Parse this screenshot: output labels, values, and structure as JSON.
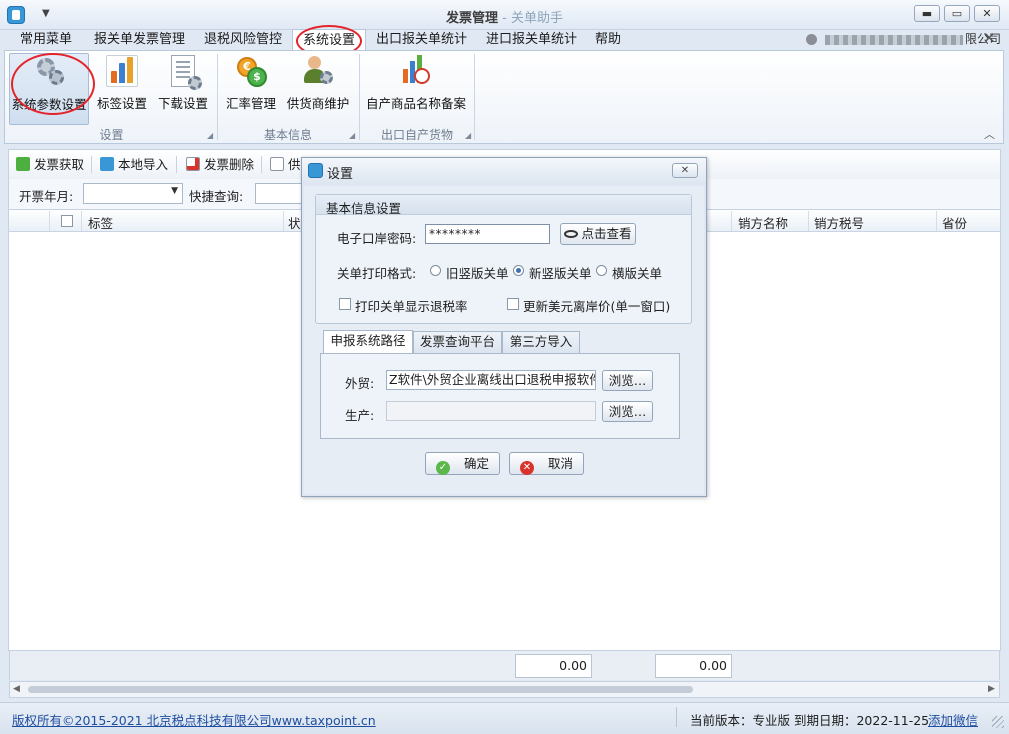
{
  "window": {
    "title_main": "发票管理",
    "title_sep": " - ",
    "title_app": "关单助手",
    "btn_min": "▬",
    "btn_max": "▭",
    "btn_close": "✕"
  },
  "ribbon_tabs": [
    "常用菜单",
    "报关单发票管理",
    "退税风险管控",
    "系统设置",
    "出口报关单统计",
    "进口报关单统计",
    "帮助"
  ],
  "company": {
    "prefix": "",
    "suffix": "限公司"
  },
  "ribbon": {
    "groups": [
      {
        "label": "设置",
        "items": [
          "系统参数设置",
          "标签设置",
          "下载设置"
        ]
      },
      {
        "label": "基本信息",
        "items": [
          "汇率管理",
          "供货商维护"
        ]
      },
      {
        "label": "出口自产货物",
        "items": [
          "自产商品名称备案"
        ]
      }
    ]
  },
  "toolbar": {
    "items": [
      "发票获取",
      "本地导入",
      "发票删除",
      "供"
    ]
  },
  "filter": {
    "year_month_label": "开票年月:",
    "quick_query_label": "快捷查询:"
  },
  "grid": {
    "headers": {
      "tag": "标签",
      "status": "状",
      "seller_name": "销方名称",
      "seller_tax": "销方税号",
      "province": "省份"
    },
    "totals": [
      "0.00",
      "0.00"
    ]
  },
  "statusbar": {
    "copyright": "版权所有©2015-2021 北京税点科技有限公司www.taxpoint.cn",
    "version": "当前版本：专业版  到期日期：2022-11-25",
    "add_wechat": "添加微信"
  },
  "dialog": {
    "title": "设置",
    "close": "✕",
    "basic_group": "基本信息设置",
    "password_label": "电子口岸密码:",
    "password_value": "********",
    "view_button": "点击查看",
    "print_label": "关单打印格式:",
    "print_options": [
      "旧竖版关单",
      "新竖版关单",
      "横版关单"
    ],
    "print_selected": 1,
    "checkbox_rebate": "打印关单显示退税率",
    "checkbox_usd": "更新美元离岸价(单一窗口)",
    "tabs": [
      "申报系统路径",
      "发票查询平台",
      "第三方导入"
    ],
    "foreign_label": "外贸:",
    "foreign_path": "Z软件\\外贸企业离线出口退税申报软件",
    "production_label": "生产:",
    "production_path": "",
    "browse": "浏览…",
    "ok": "确定",
    "cancel": "取消"
  },
  "colors": {
    "accent": "#3a97d6",
    "annotation": "#e4242a",
    "link": "#1f4ea0"
  }
}
